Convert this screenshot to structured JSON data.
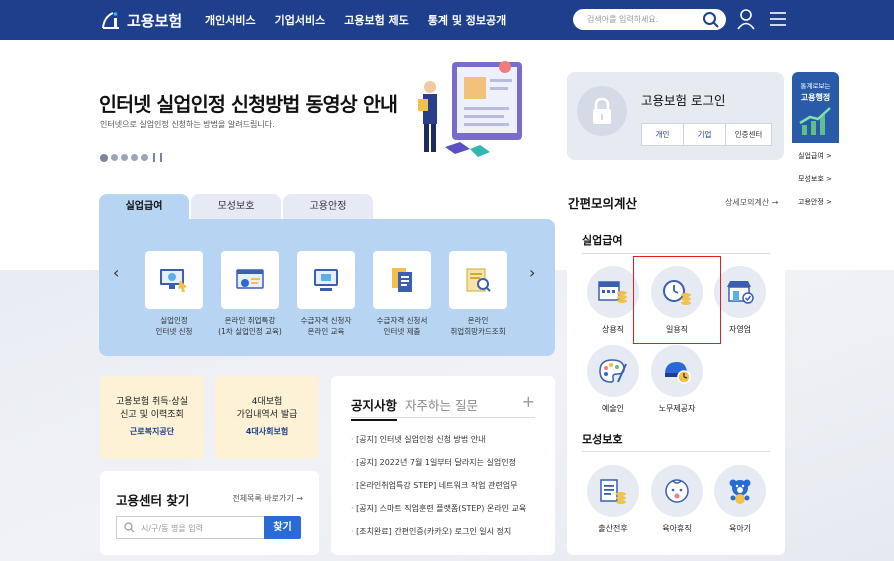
{
  "header": {
    "logo_text": "고용보험",
    "nav": [
      "개인서비스",
      "기업서비스",
      "고용보험 제도",
      "통계 및 정보공개"
    ],
    "search_placeholder": "검색어를 입력하세요."
  },
  "hero": {
    "title": "인터넷 실업인정 신청방법 동영상 안내",
    "subtitle": "인터넷으로 실업인정 신청하는 방법을 알려드립니다."
  },
  "service_tabs": {
    "tabs": [
      "실업급여",
      "모성보호",
      "고용안정"
    ],
    "active": 0,
    "items": [
      {
        "label": "실업인정\n인터넷 신청",
        "icon": "monitor-click-icon"
      },
      {
        "label": "온라인 취업특강\n(1차 실업인정 교육)",
        "icon": "video-lecture-icon"
      },
      {
        "label": "수급자격 신청자\n온라인 교육",
        "icon": "online-education-icon"
      },
      {
        "label": "수급자격 신청서\n인터넷 제출",
        "icon": "document-submit-icon"
      },
      {
        "label": "온라인\n취업희망카드조회",
        "icon": "card-search-icon"
      }
    ]
  },
  "quick_cards": [
    {
      "text": "고용보험 취득·상실\n신고 및 이력조회",
      "org": "근로복지공단"
    },
    {
      "text": "4대보험\n가입내역서 발급",
      "org": "4대사회보험"
    }
  ],
  "center_search": {
    "title": "고용센터 찾기",
    "link": "전체목록 바로가기 →",
    "placeholder": "시/구/동 명을 입력",
    "button": "찾기"
  },
  "notice": {
    "tabs": [
      "공지사항",
      "자주하는 질문"
    ],
    "plus": "+",
    "items": [
      "[공지] 인터넷 실업인정 신청 방법 안내",
      "[공지] 2022년 7월 1일부터 달라지는 실업인정",
      "[온라인취업특강 STEP] 네트워크 작업 관련업무",
      "[공지] 스마트 직업훈련 플랫폼(STEP) 온라인 교육",
      "[조치완료] 간편인증(카카오) 로그인 일시 정지"
    ]
  },
  "login": {
    "title": "고용보험 로그인",
    "buttons": [
      "개인",
      "기업",
      "인증센터"
    ]
  },
  "side_banner": {
    "line1": "통계로보는",
    "line2": "고용행정",
    "items": [
      "실업급여 >",
      "모성보호 >",
      "고용안정 >"
    ]
  },
  "calc": {
    "title": "간편모의계산",
    "link": "상세모의계산 →",
    "section1": "실업급여",
    "section1_items": [
      {
        "label": "상용직",
        "icon": "calendar-coins-icon"
      },
      {
        "label": "일용직",
        "icon": "clock-coins-icon"
      },
      {
        "label": "자영업",
        "icon": "shop-icon"
      },
      {
        "label": "예술인",
        "icon": "palette-icon"
      },
      {
        "label": "노무제공자",
        "icon": "helmet-icon"
      }
    ],
    "section2": "모성보호",
    "section2_items": [
      {
        "label": "출산전후",
        "icon": "document-coins-icon"
      },
      {
        "label": "육아휴직",
        "icon": "baby-icon"
      },
      {
        "label": "육아기",
        "icon": "teddy-bear-icon"
      }
    ]
  },
  "colors": {
    "header": "#1d3f8c",
    "tab_panel": "#b7d4f3",
    "card_yellow": "#fdf1d6",
    "button_blue": "#2a6ad6",
    "highlight": "#e02020"
  }
}
